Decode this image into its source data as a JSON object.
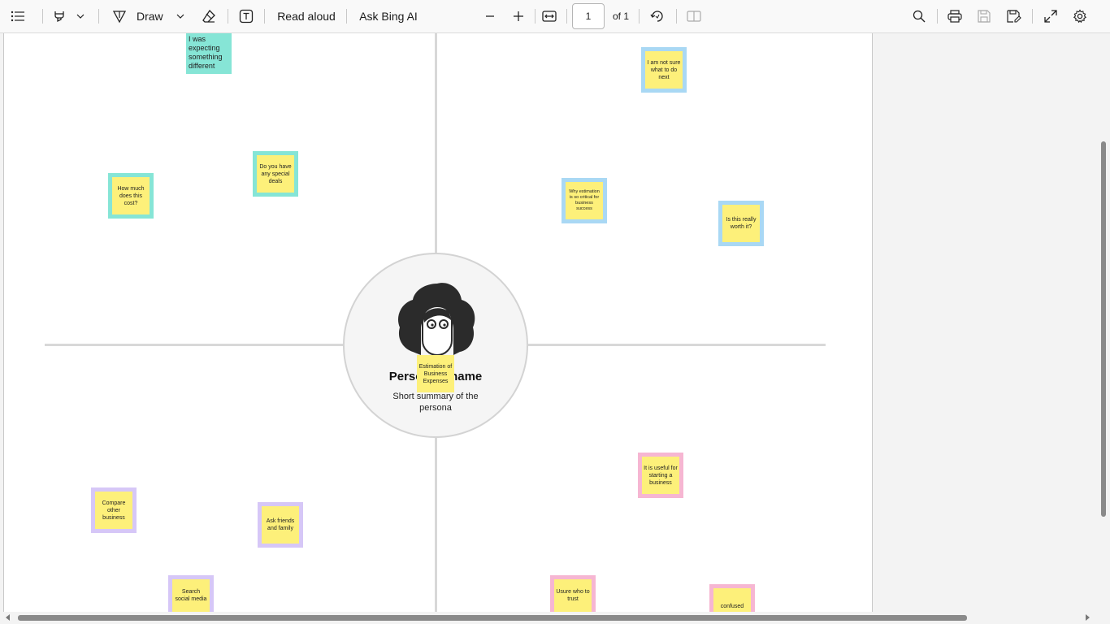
{
  "toolbar": {
    "contents_icon": "list-icon",
    "highlight_icon": "highlighter-icon",
    "draw_label": "Draw",
    "erase_icon": "eraser-icon",
    "textbox_icon": "text-box-icon",
    "read_aloud_label": "Read aloud",
    "ask_bing_label": "Ask Bing AI",
    "zoom_out_icon": "minus-icon",
    "zoom_in_icon": "plus-icon",
    "fit_icon": "fit-width-icon",
    "page_number": "1",
    "page_total": "of 1",
    "rotate_icon": "rotate-icon",
    "two_page_icon": "two-page-icon",
    "search_icon": "search-icon",
    "print_icon": "print-icon",
    "save_icon": "save-icon",
    "save_as_icon": "save-as-icon",
    "fullscreen_icon": "expand-icon",
    "settings_icon": "gear-icon"
  },
  "persona": {
    "name": "Persona’s name",
    "summary": "Short summary of the persona",
    "center_note": "Estimation of Business Expenses"
  },
  "notes": {
    "top_left_cut": "I was expecting something different",
    "how_much": "How much does this cost?",
    "special_deals": "Do you have any special deals",
    "not_sure": "I am not sure what to do next",
    "why_estimation": "Why estimation is so critical for business success",
    "worth_it": "Is this really worth it?",
    "compare": "Compare other business",
    "ask_friends": "Ask friends and family",
    "social_media": "Search social media",
    "useful": "It is useful for starting a business",
    "unsure_trust": "Usure who to trust",
    "confused": "confused"
  },
  "colors": {
    "sticky": "#fdf07a",
    "teal": "#86e5d6",
    "blue": "#a9d8f4",
    "purple": "#d6c7f7",
    "pink": "#f6b6d2"
  }
}
